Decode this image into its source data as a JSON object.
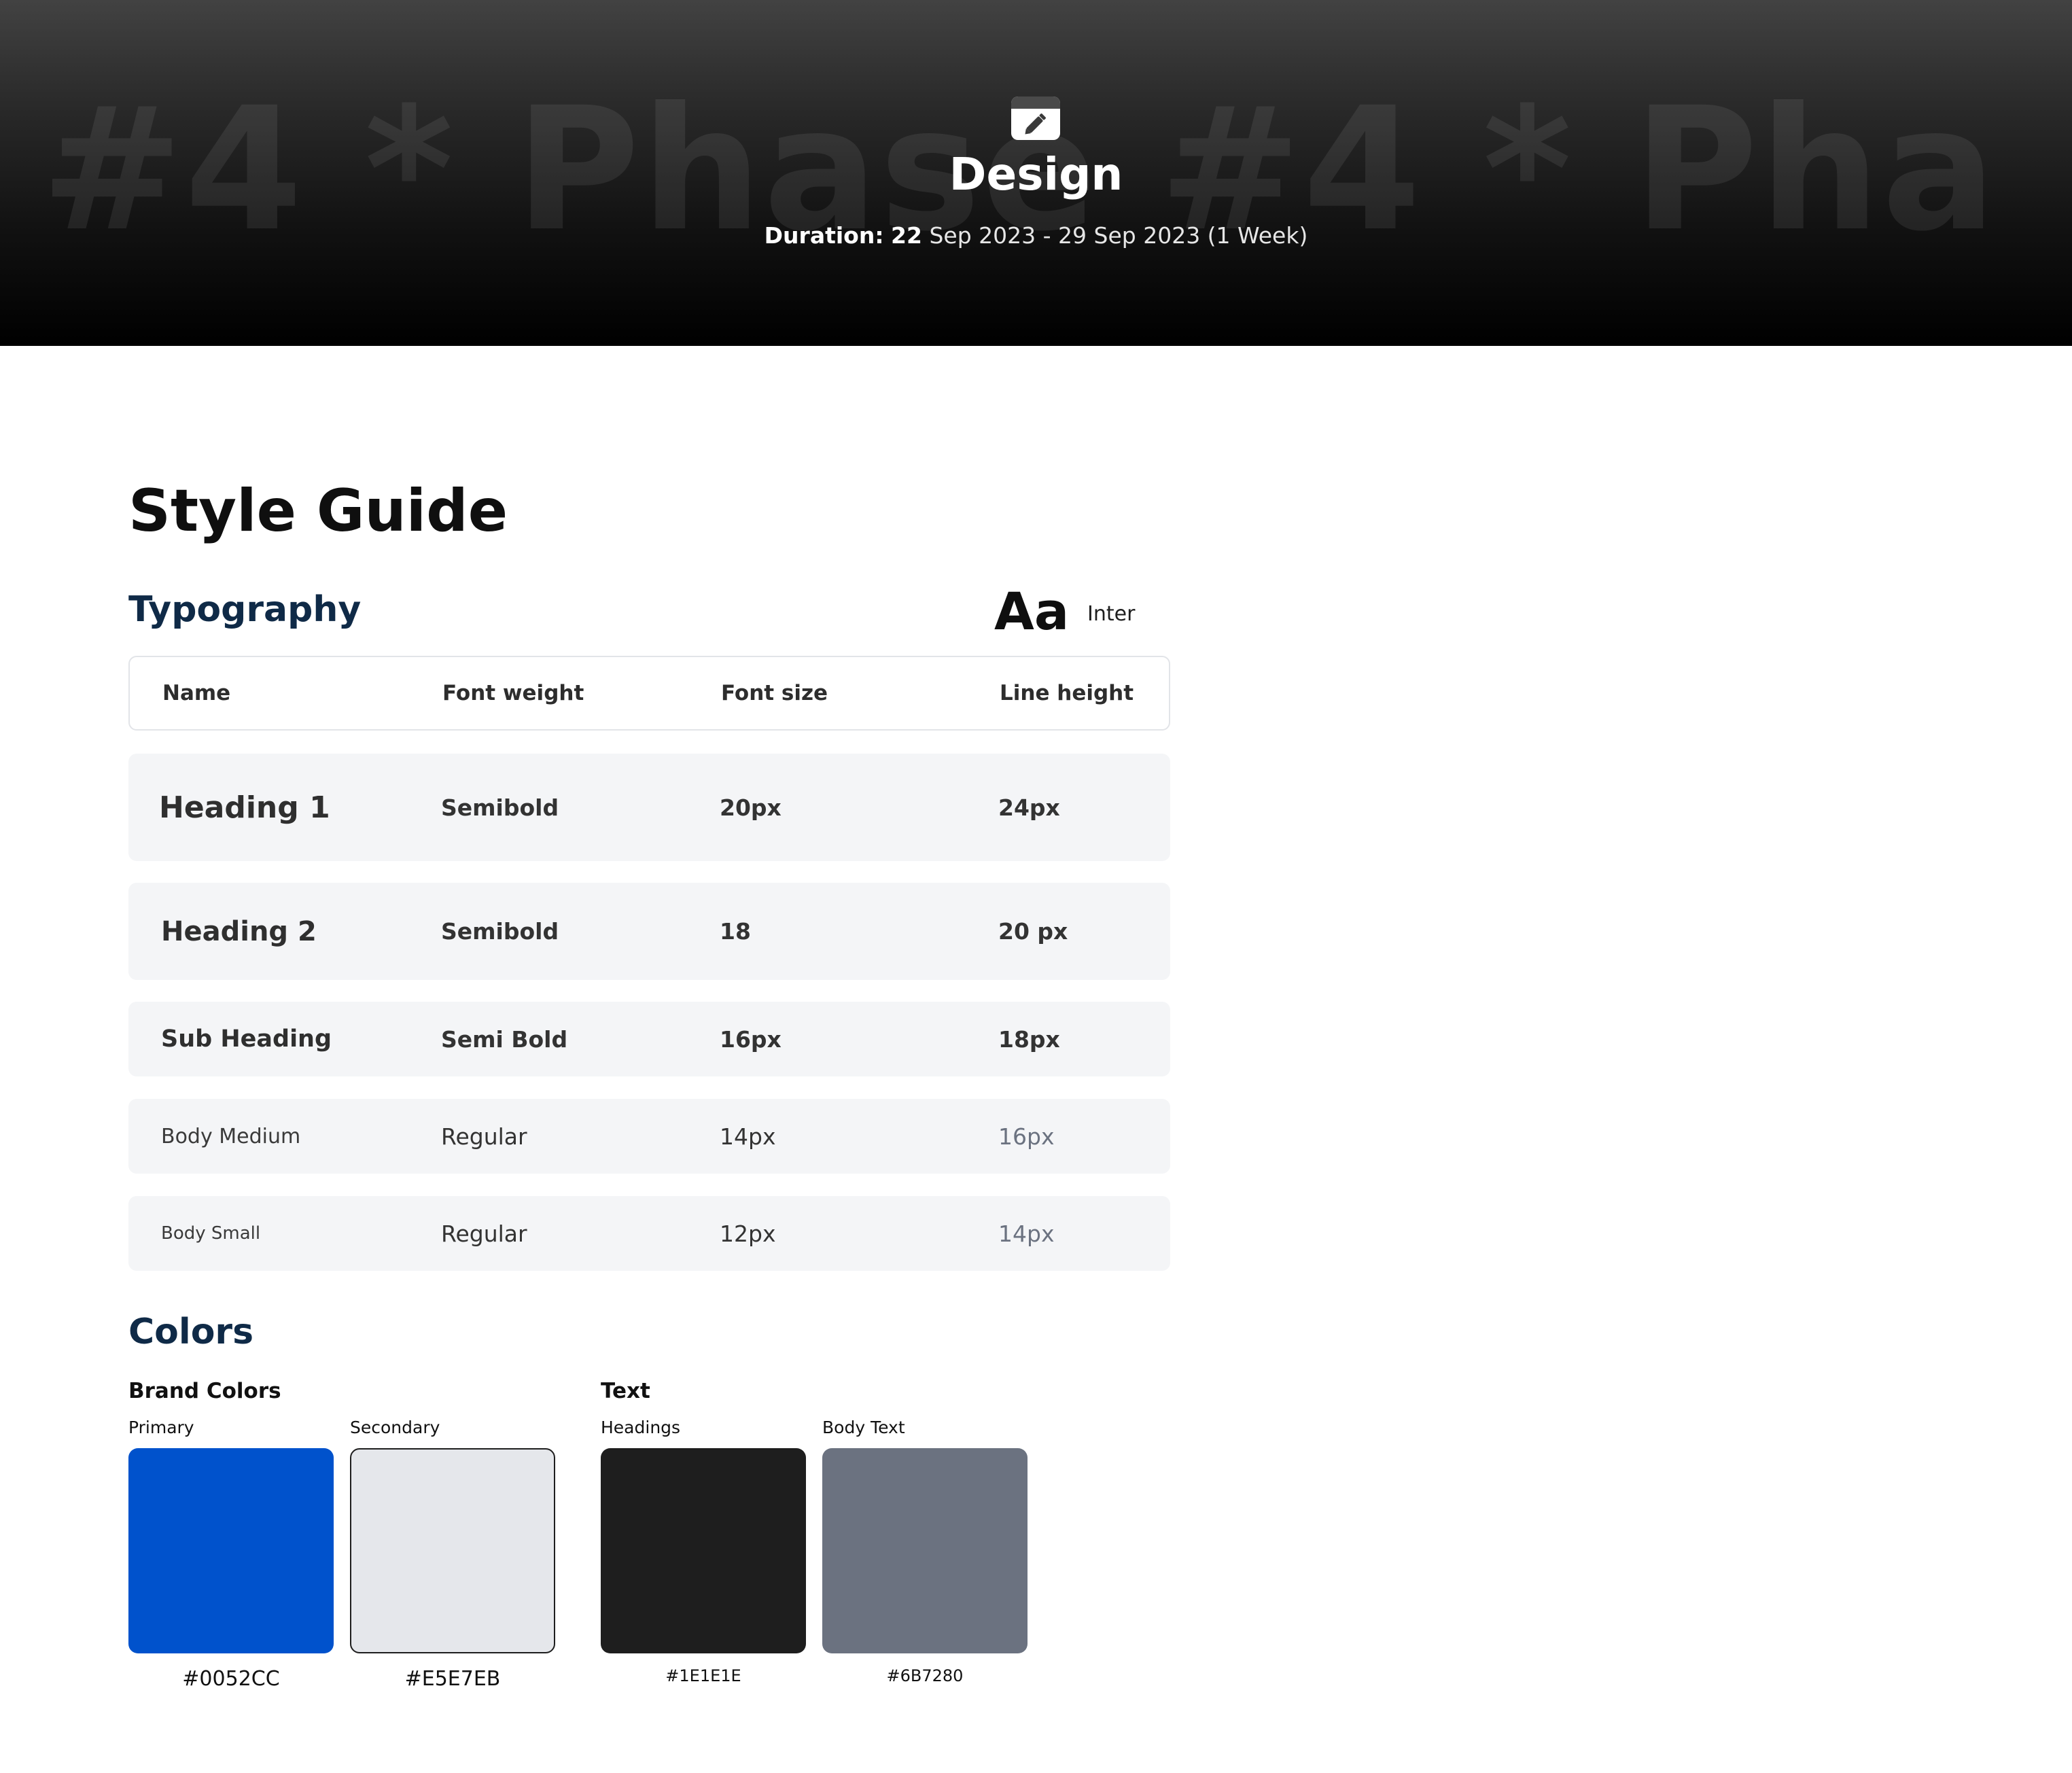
{
  "hero": {
    "watermark": "#4    *    Phase #4    *    Pha",
    "title": "Design",
    "duration_label": "Duration:",
    "duration_day": "22",
    "duration_rest": "Sep 2023 -  29 Sep 2023 (1 Week)",
    "icon": "pencil-calendar-icon"
  },
  "style_guide": {
    "title": "Style Guide"
  },
  "typography": {
    "title": "Typography",
    "sample": "Aa",
    "font_name": "Inter",
    "headers": {
      "name": "Name",
      "weight": "Font weight",
      "size": "Font size",
      "line": "Line height"
    },
    "rows": [
      {
        "name": "Heading 1",
        "weight": "Semibold",
        "size": "20px",
        "line": "24px"
      },
      {
        "name": "Heading 2",
        "weight": "Semibold",
        "size": "18",
        "line": "20 px"
      },
      {
        "name": "Sub Heading",
        "weight": "Semi Bold",
        "size": "16px",
        "line": "18px"
      },
      {
        "name": "Body Medium",
        "weight": "Regular",
        "size": "14px",
        "line": "16px"
      },
      {
        "name": "Body Small",
        "weight": "Regular",
        "size": "12px",
        "line": "14px"
      }
    ]
  },
  "colors": {
    "title": "Colors",
    "brand": {
      "label": "Brand Colors",
      "primary": {
        "label": "Primary",
        "hex": "#0052CC",
        "color": "#0052CC"
      },
      "secondary": {
        "label": "Secondary",
        "hex": "#E5E7EB",
        "color": "#E5E7EB"
      }
    },
    "text": {
      "label": "Text",
      "headings": {
        "label": "Headings",
        "hex": "#1E1E1E",
        "color": "#1E1E1E"
      },
      "body": {
        "label": "Body Text",
        "hex": "#6B7280",
        "color": "#6B7280"
      }
    }
  }
}
